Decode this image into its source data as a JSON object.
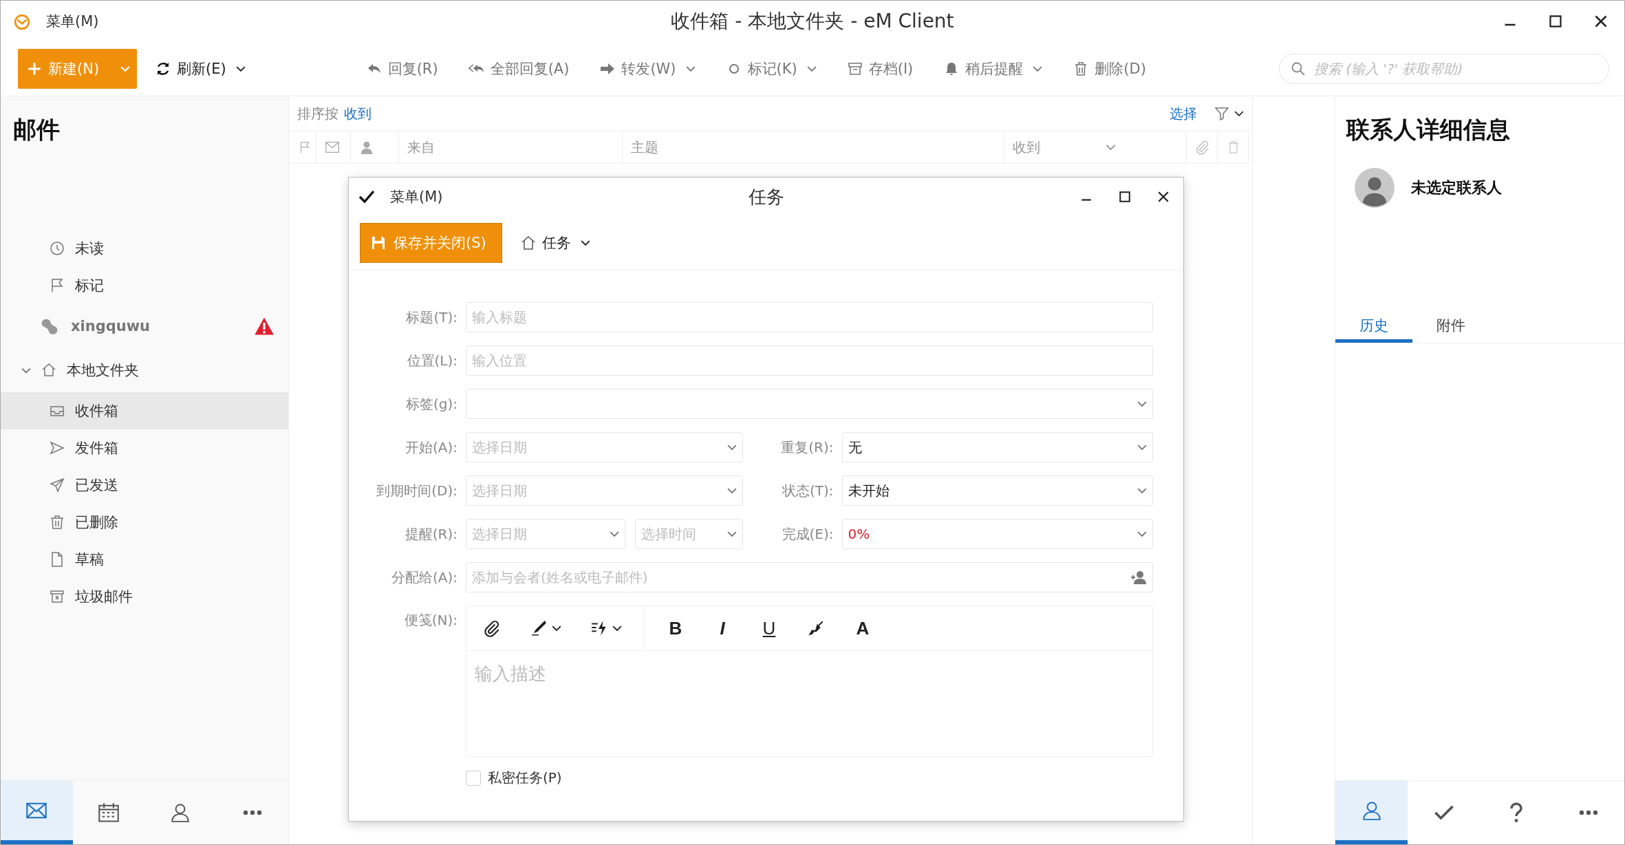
{
  "app": {
    "menu": "菜单(M)",
    "title": "收件箱 - 本地文件夹 - eM Client"
  },
  "toolbar": {
    "new_button": "新建(N)",
    "refresh": "刷新(E)",
    "actions": [
      {
        "kind": "reply",
        "label": "回复(R)",
        "dropdown": false
      },
      {
        "kind": "reply-all",
        "label": "全部回复(A)",
        "dropdown": false
      },
      {
        "kind": "forward",
        "label": "转发(W)",
        "dropdown": true
      },
      {
        "kind": "flag",
        "label": "标记(K)",
        "dropdown": true
      },
      {
        "kind": "archive",
        "label": "存档(I)",
        "dropdown": false
      },
      {
        "kind": "reminder",
        "label": "稍后提醒",
        "dropdown": true
      },
      {
        "kind": "delete",
        "label": "删除(D)",
        "dropdown": false
      }
    ],
    "search": {
      "placeholder": "搜索 (输入 '?' 获取帮助)"
    }
  },
  "sidebar": {
    "heading": "邮件",
    "items": [
      {
        "kind": "unread",
        "label": "未读",
        "selected": false
      },
      {
        "kind": "flagged",
        "label": "标记",
        "selected": false
      },
      {
        "kind": "account",
        "label": "xingquwu",
        "selected": false,
        "warning": true
      },
      {
        "kind": "local",
        "label": "本地文件夹",
        "selected": false,
        "expanded": true
      },
      {
        "kind": "inbox",
        "label": "收件箱",
        "selected": true
      },
      {
        "kind": "outbox",
        "label": "发件箱",
        "selected": false
      },
      {
        "kind": "sent",
        "label": "已发送",
        "selected": false
      },
      {
        "kind": "deleted",
        "label": "已删除",
        "selected": false
      },
      {
        "kind": "drafts",
        "label": "草稿",
        "selected": false
      },
      {
        "kind": "junk",
        "label": "垃圾邮件",
        "selected": false
      }
    ],
    "nav": [
      {
        "kind": "mail",
        "selected": true
      },
      {
        "kind": "calendar",
        "selected": false
      },
      {
        "kind": "contacts",
        "selected": false
      },
      {
        "kind": "more",
        "selected": false
      }
    ]
  },
  "message_list": {
    "sort_label": "排序按",
    "sort_value": "收到",
    "select": "选择",
    "columns": [
      {
        "label": "来自"
      },
      {
        "label": "主题"
      },
      {
        "label": "收到"
      }
    ]
  },
  "contact_panel": {
    "heading": "联系人详细信息",
    "contact": "未选定联系人",
    "tabs": [
      {
        "label": "历史",
        "selected": true
      },
      {
        "label": "附件",
        "selected": false
      }
    ],
    "nav": [
      {
        "kind": "contact",
        "selected": true
      },
      {
        "kind": "tasks",
        "selected": false
      },
      {
        "kind": "help",
        "selected": false
      },
      {
        "kind": "more",
        "selected": false
      }
    ]
  },
  "task_dialog": {
    "menu": "菜单(M)",
    "title": "任务",
    "save_button": "保存并关闭(S)",
    "type_menu": "任务",
    "rows": [
      [
        {
          "kind": "text",
          "label": "标题(T):",
          "placeholder": "输入标题"
        }
      ],
      [
        {
          "kind": "text",
          "label": "位置(L):",
          "placeholder": "输入位置"
        }
      ],
      [
        {
          "kind": "select",
          "label": "标签(g):"
        }
      ],
      [
        {
          "kind": "select",
          "label": "开始(A):",
          "placeholder": "选择日期"
        },
        {
          "kind": "select",
          "label": "重复(R):",
          "value": "无"
        }
      ],
      [
        {
          "kind": "select",
          "label": "到期时间(D):",
          "placeholder": "选择日期"
        },
        {
          "kind": "select",
          "label": "状态(T):",
          "value": "未开始"
        }
      ],
      [
        {
          "kind": "split",
          "label": "提醒(R):",
          "parts": [
            "选择日期",
            "选择时间"
          ]
        },
        {
          "kind": "select",
          "label": "完成(E):",
          "value": "0%",
          "alert": true
        }
      ],
      [
        {
          "kind": "people",
          "label": "分配给(A):",
          "placeholder": "添加与会者(姓名或电子邮件)"
        }
      ]
    ],
    "notes": {
      "label": "便笺(N):",
      "placeholder": "输入描述",
      "tools": [
        {
          "kind": "attach",
          "dropdown": false
        },
        {
          "kind": "signature",
          "dropdown": true
        },
        {
          "kind": "quick-text",
          "dropdown": true
        },
        {
          "kind": "bold",
          "glyph": "B",
          "dropdown": false
        },
        {
          "kind": "italic",
          "glyph": "I",
          "dropdown": false
        },
        {
          "kind": "underline",
          "glyph": "U",
          "dropdown": false
        },
        {
          "kind": "clear",
          "dropdown": false
        },
        {
          "kind": "color",
          "glyph": "A",
          "dropdown": false
        }
      ]
    },
    "private": {
      "label": "私密任务(P)",
      "checked": false
    }
  }
}
